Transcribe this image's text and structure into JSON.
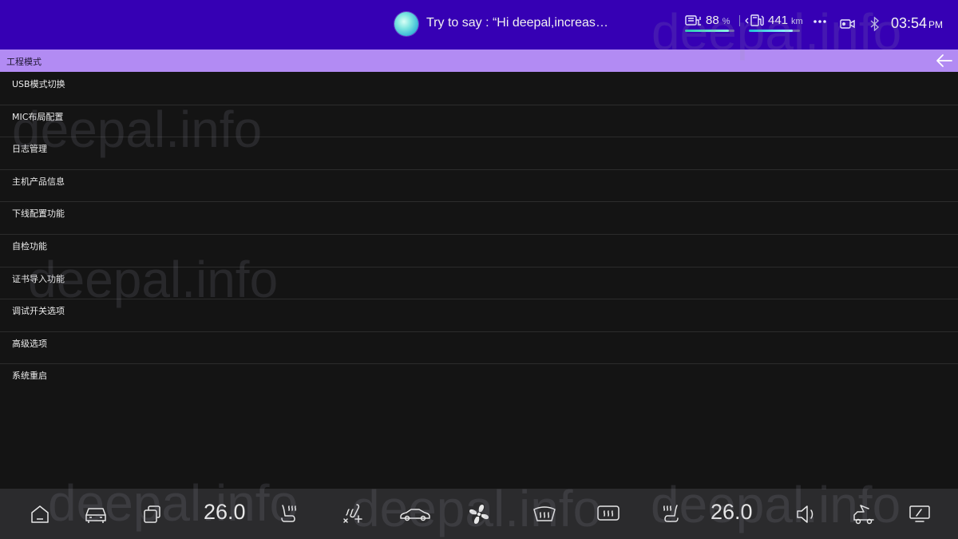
{
  "status_bar": {
    "voice_hint": "Try to say : “Hi deepal,increase t...",
    "battery": {
      "value": "88",
      "unit": "%",
      "level": 0.88
    },
    "range": {
      "value": "441",
      "unit": "km",
      "level": 0.86
    },
    "time": "03:54",
    "ampm": "PM",
    "icons": [
      "voice-assistant-icon",
      "battery-charge-icon",
      "fuel-range-icon",
      "more-icon",
      "camera-icon",
      "bluetooth-icon"
    ]
  },
  "header": {
    "title": "工程模式",
    "back_icon": "arrow-left-icon"
  },
  "menu": {
    "items": [
      {
        "label": "USB模式切换"
      },
      {
        "label": "MIC布局配置"
      },
      {
        "label": "日志管理"
      },
      {
        "label": "主机产品信息"
      },
      {
        "label": "下线配置功能"
      },
      {
        "label": "自检功能"
      },
      {
        "label": "证书导入功能"
      },
      {
        "label": "调试开关选项"
      },
      {
        "label": "高级选项"
      },
      {
        "label": "系统重启"
      }
    ]
  },
  "watermark": {
    "text": "deepal.info"
  },
  "dock": {
    "left_temp": "26.0",
    "right_temp": "26.0",
    "icons": [
      "home-icon",
      "car-icon",
      "multitask-icon",
      "seat-heat-left-icon",
      "airflow-icon",
      "car-side-icon",
      "fan-icon",
      "front-defrost-icon",
      "rear-defrost-icon",
      "seat-heat-right-icon",
      "volume-icon",
      "tailgate-icon",
      "screen-off-icon"
    ]
  },
  "colors": {
    "status_bar_bg": "#3600b4",
    "header_bg": "#b28bf3",
    "body_bg": "#141414",
    "dock_bg": "#2b2b2d",
    "accent_teal": "#28c7b4"
  }
}
